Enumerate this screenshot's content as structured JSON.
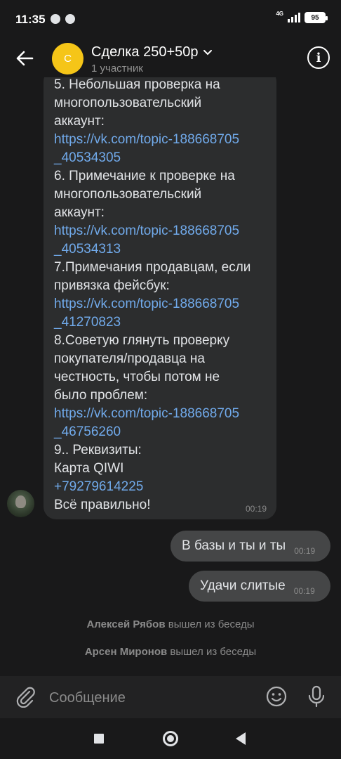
{
  "status_bar": {
    "time": "11:35",
    "network": "4G",
    "battery": "95",
    "icons": [
      "chat-bubble-icon",
      "message-bubble-icon",
      "signal-icon",
      "battery-icon"
    ]
  },
  "header": {
    "back_icon": "arrow-left-icon",
    "avatar_letter": "С",
    "avatar_color": "#f5c518",
    "title": "Сделка 250+50р",
    "subtitle": "1 участник",
    "info_icon": "info-icon"
  },
  "incoming_message": {
    "lines": [
      {
        "text": "5. Небольшая проверка на",
        "link": false
      },
      {
        "text": "многопользовательский",
        "link": false
      },
      {
        "text": "аккаунт:",
        "link": false
      },
      {
        "text": "https://vk.com/topic-188668705",
        "link": true
      },
      {
        "text": "_40534305",
        "link": true
      },
      {
        "text": "6. Примечание к проверке на",
        "link": false
      },
      {
        "text": "многопользовательский",
        "link": false
      },
      {
        "text": "аккаунт:",
        "link": false
      },
      {
        "text": "https://vk.com/topic-188668705",
        "link": true
      },
      {
        "text": "_40534313",
        "link": true
      },
      {
        "text": "7.Примечания продавцам, если",
        "link": false
      },
      {
        "text": "привязка фейсбук:",
        "link": false
      },
      {
        "text": "https://vk.com/topic-188668705",
        "link": true
      },
      {
        "text": "_41270823",
        "link": true
      },
      {
        "text": "8.Советую глянуть проверку",
        "link": false
      },
      {
        "text": "покупателя/продавца на",
        "link": false
      },
      {
        "text": "честность, чтобы потом не",
        "link": false
      },
      {
        "text": "было проблем:",
        "link": false
      },
      {
        "text": "https://vk.com/topic-188668705",
        "link": true
      },
      {
        "text": "_46756260",
        "link": true
      },
      {
        "text": "9.. Реквизиты:",
        "link": false
      },
      {
        "text": "Карта QIWI",
        "link": false
      },
      {
        "text": "+79279614225",
        "link": true
      },
      {
        "text": "Всё правильно!",
        "link": false
      }
    ],
    "time": "00:19"
  },
  "outgoing_messages": [
    {
      "text": "В базы и ты и ты",
      "time": "00:19"
    },
    {
      "text": "Удачи слитые",
      "time": "00:19"
    }
  ],
  "service_messages": [
    {
      "name": "Алексей Рябов",
      "action": "вышел из беседы"
    },
    {
      "name": "Арсен Миронов",
      "action": "вышел из беседы"
    }
  ],
  "composer": {
    "placeholder": "Сообщение",
    "attach_icon": "paperclip-icon",
    "emoji_icon": "smile-icon",
    "mic_icon": "microphone-icon"
  },
  "colors": {
    "background": "#19191a",
    "bubble_in": "#2c2d2e",
    "bubble_out": "#454647",
    "link": "#71aaeb"
  }
}
